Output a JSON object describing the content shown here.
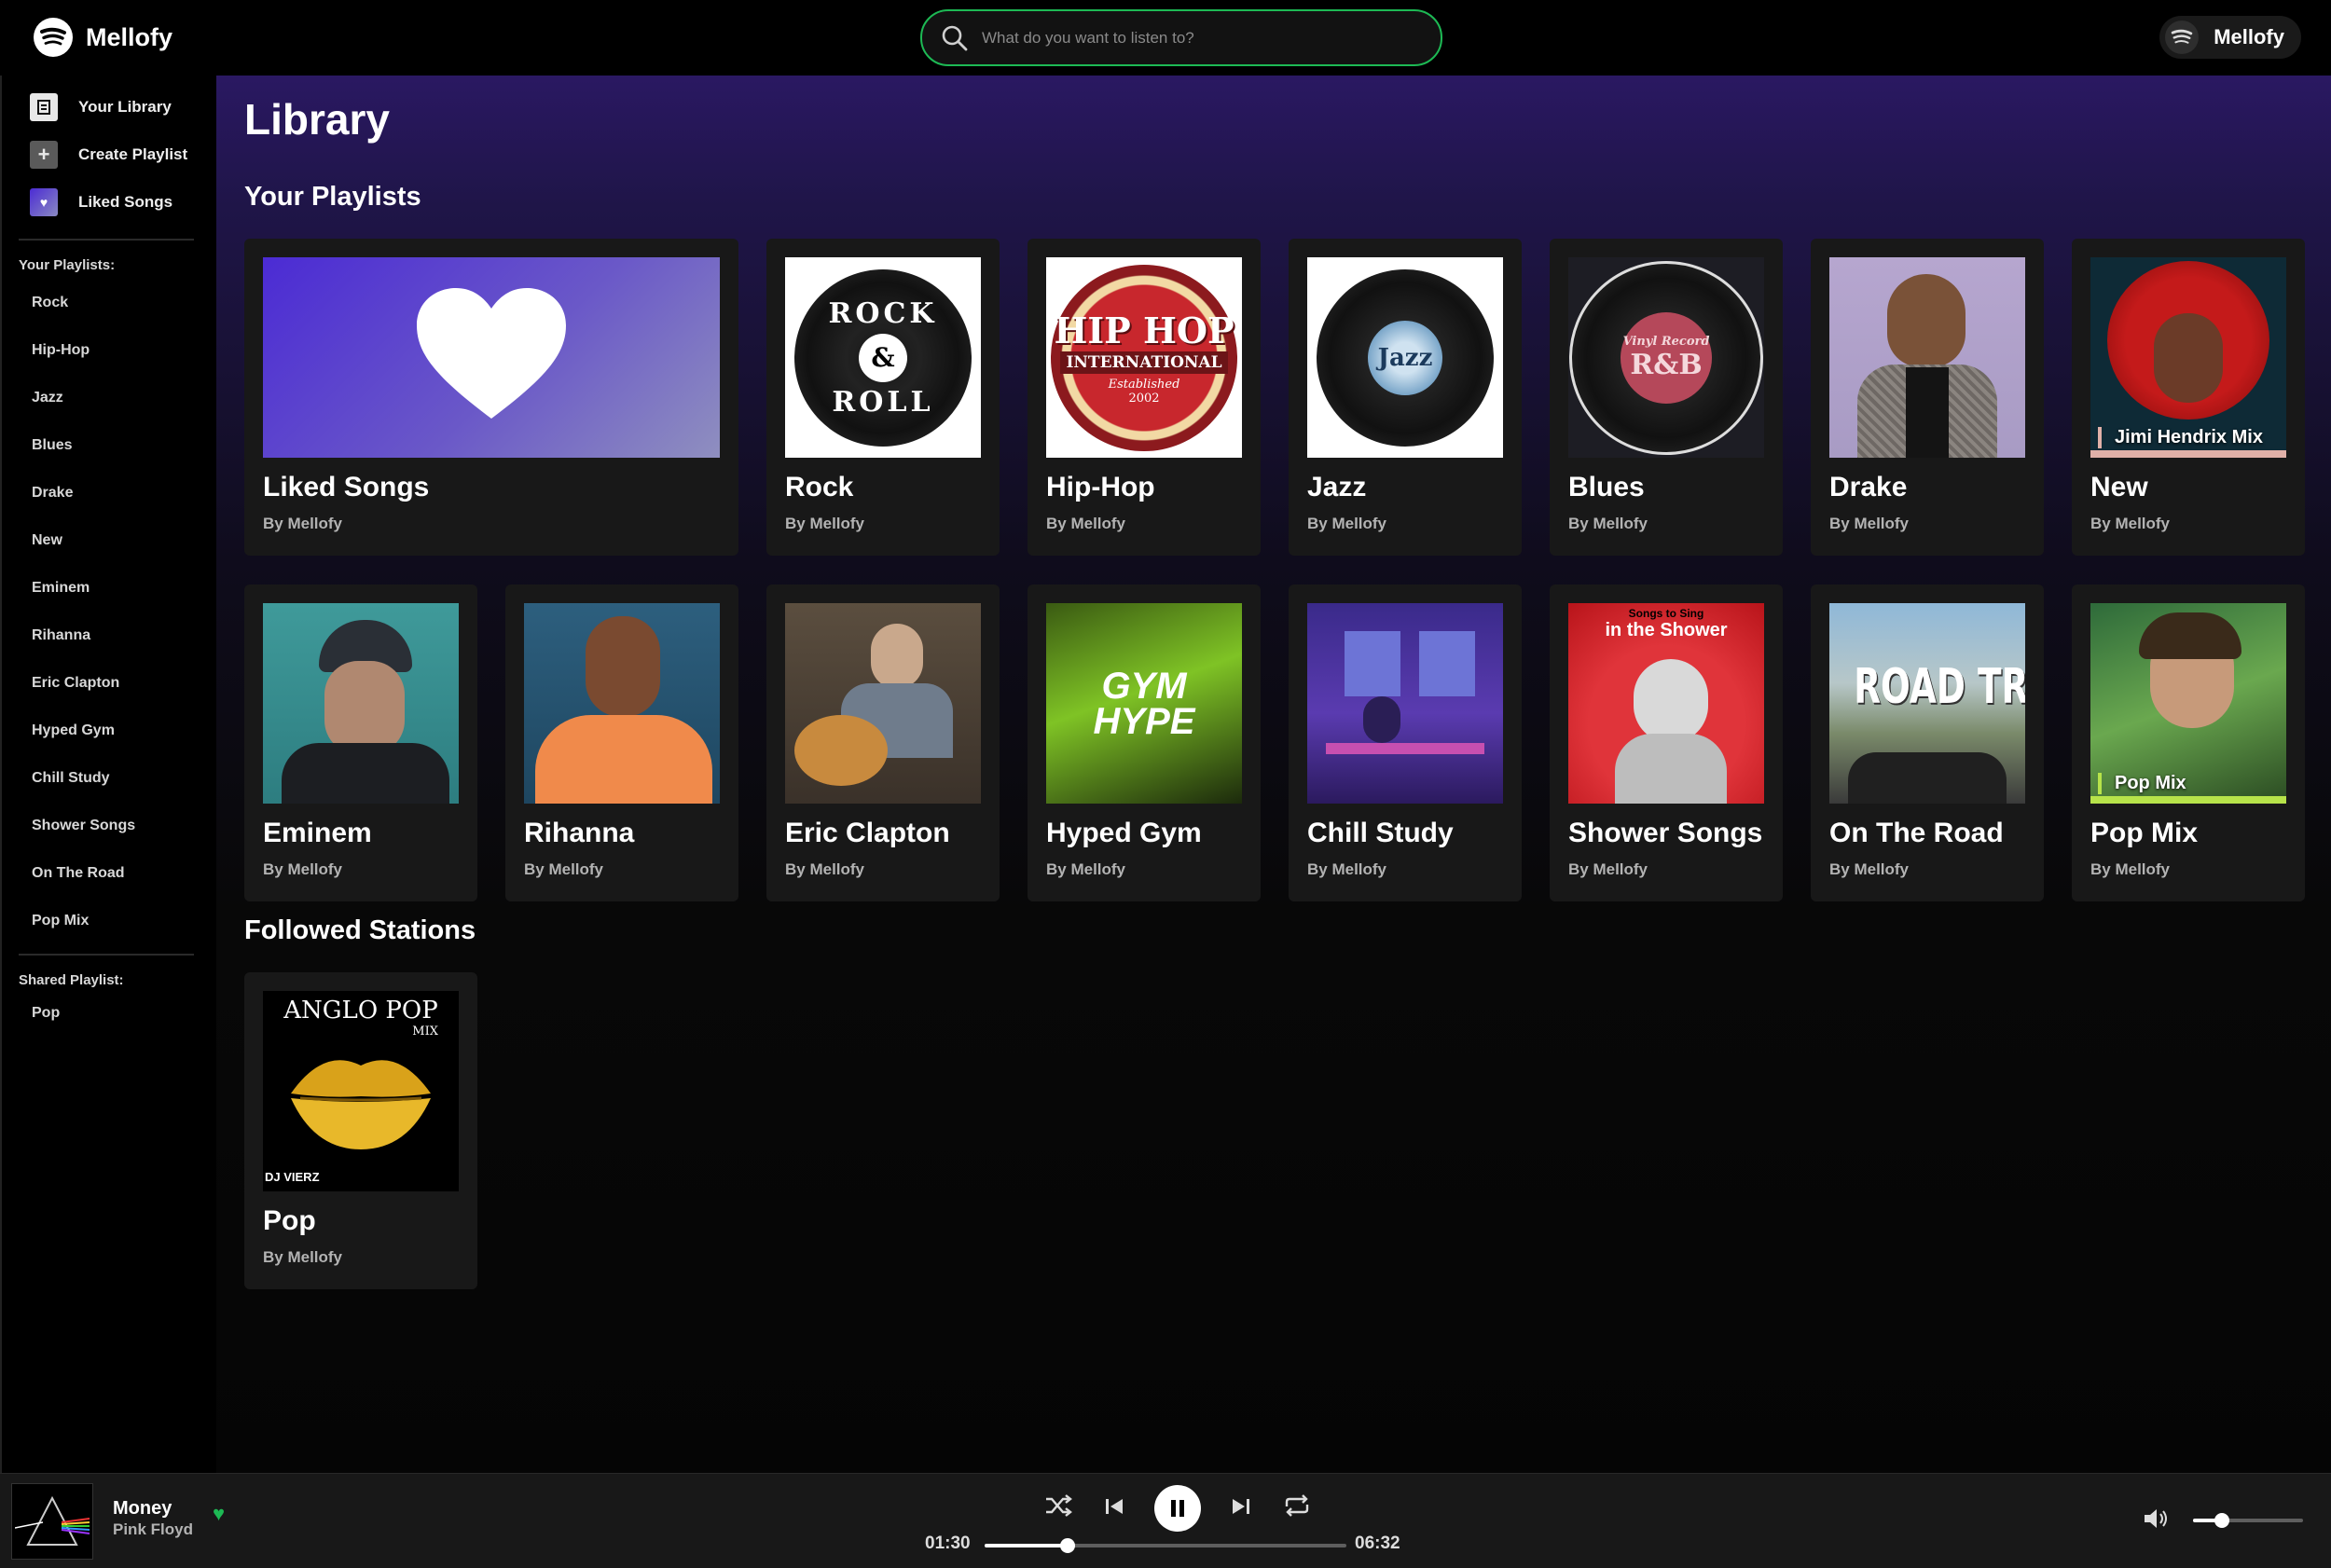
{
  "app": {
    "name": "Mellofy"
  },
  "search": {
    "placeholder": "What do you want to listen to?"
  },
  "user": {
    "name": "Mellofy"
  },
  "sidebar": {
    "nav": [
      {
        "label": "Your Library",
        "icon": "library-icon"
      },
      {
        "label": "Create Playlist",
        "icon": "plus-icon"
      },
      {
        "label": "Liked Songs",
        "icon": "heart-icon"
      }
    ],
    "playlists_label": "Your Playlists:",
    "playlists": [
      "Rock",
      "Hip-Hop",
      "Jazz",
      "Blues",
      "Drake",
      "New",
      "Eminem",
      "Rihanna",
      "Eric Clapton",
      "Hyped Gym",
      "Chill Study",
      "Shower Songs",
      "On The Road",
      "Pop Mix"
    ],
    "shared_label": "Shared Playlist:",
    "shared": [
      "Pop"
    ]
  },
  "main": {
    "title": "Library",
    "playlists_title": "Your Playlists",
    "stations_title": "Followed Stations",
    "row1": [
      {
        "name": "Liked Songs",
        "by": "By Mellofy"
      },
      {
        "name": "Rock",
        "by": "By Mellofy",
        "cover_text": [
          "ROCK",
          "&",
          "ROLL"
        ]
      },
      {
        "name": "Hip-Hop",
        "by": "By Mellofy",
        "cover_text": [
          "HIP HOP",
          "INTERNATIONAL",
          "Established",
          "2002"
        ]
      },
      {
        "name": "Jazz",
        "by": "By Mellofy",
        "cover_text": "Jazz"
      },
      {
        "name": "Blues",
        "by": "By Mellofy",
        "cover_text": [
          "Vinyl Record",
          "R&B"
        ]
      },
      {
        "name": "Drake",
        "by": "By Mellofy"
      },
      {
        "name": "New",
        "by": "By Mellofy",
        "cover_text": "Jimi Hendrix Mix"
      }
    ],
    "row2": [
      {
        "name": "Eminem",
        "by": "By Mellofy"
      },
      {
        "name": "Rihanna",
        "by": "By Mellofy"
      },
      {
        "name": "Eric Clapton",
        "by": "By Mellofy"
      },
      {
        "name": "Hyped Gym",
        "by": "By Mellofy",
        "cover_text": [
          "GYM",
          "HYPE"
        ]
      },
      {
        "name": "Chill Study",
        "by": "By Mellofy"
      },
      {
        "name": "Shower Songs",
        "by": "By Mellofy",
        "cover_text": [
          "Songs to Sing",
          "in the Shower"
        ]
      },
      {
        "name": "On The Road",
        "by": "By Mellofy",
        "cover_text": "ROAD TRIP"
      },
      {
        "name": "Pop Mix",
        "by": "By Mellofy",
        "cover_text": "Pop Mix"
      }
    ],
    "stations": [
      {
        "name": "Pop",
        "by": "By Mellofy",
        "cover_text": [
          "ANGLO POP",
          "MIX",
          "DJ VIERZ"
        ]
      }
    ]
  },
  "player": {
    "title": "Money",
    "artist": "Pink Floyd",
    "elapsed": "01:30",
    "duration": "06:32",
    "progress": 0.23,
    "volume": 0.26,
    "liked_color": "#1db954"
  },
  "colors": {
    "accent": "#1db954",
    "header_purple": "#2a1862"
  }
}
